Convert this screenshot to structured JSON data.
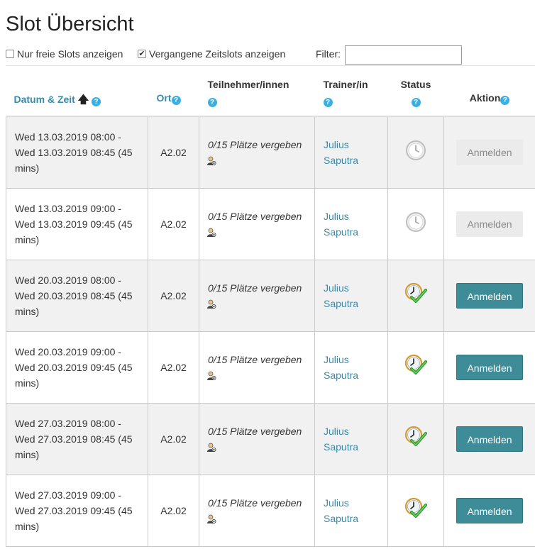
{
  "page": {
    "title": "Slot Übersicht"
  },
  "controls": {
    "free_only_label": "Nur freie Slots anzeigen",
    "free_only_checked": false,
    "past_label": "Vergangene Zeitslots anzeigen",
    "past_checked": true,
    "filter_label": "Filter:",
    "filter_value": ""
  },
  "table": {
    "headers": {
      "datum": "Datum & Zeit",
      "ort": "Ort",
      "teilnehmer": "Teilnehmer/innen",
      "trainer": "Trainer/in",
      "status": "Status",
      "aktion": "Aktion"
    },
    "help_glyph": "?",
    "sort_glyph": "🡅",
    "rows": [
      {
        "datum": "Wed 13.03.2019 08:00 - Wed 13.03.2019 08:45 (45 mins)",
        "ort": "A2.02",
        "teilnehmer": "0/15 Plätze vergeben",
        "trainer": "Julius Saputra",
        "status": "past-clock-icon",
        "action": "Anmelden",
        "action_enabled": false
      },
      {
        "datum": "Wed 13.03.2019 09:00 - Wed 13.03.2019 09:45 (45 mins)",
        "ort": "A2.02",
        "teilnehmer": "0/15 Plätze vergeben",
        "trainer": "Julius Saputra",
        "status": "past-clock-icon",
        "action": "Anmelden",
        "action_enabled": false
      },
      {
        "datum": "Wed 20.03.2019 08:00 - Wed 20.03.2019 08:45 (45 mins)",
        "ort": "A2.02",
        "teilnehmer": "0/15 Plätze vergeben",
        "trainer": "Julius Saputra",
        "status": "open-clock-check-icon",
        "action": "Anmelden",
        "action_enabled": true
      },
      {
        "datum": "Wed 20.03.2019 09:00 - Wed 20.03.2019 09:45 (45 mins)",
        "ort": "A2.02",
        "teilnehmer": "0/15 Plätze vergeben",
        "trainer": "Julius Saputra",
        "status": "open-clock-check-icon",
        "action": "Anmelden",
        "action_enabled": true
      },
      {
        "datum": "Wed 27.03.2019 08:00 - Wed 27.03.2019 08:45 (45 mins)",
        "ort": "A2.02",
        "teilnehmer": "0/15 Plätze vergeben",
        "trainer": "Julius Saputra",
        "status": "open-clock-check-icon",
        "action": "Anmelden",
        "action_enabled": true
      },
      {
        "datum": "Wed 27.03.2019 09:00 - Wed 27.03.2019 09:45 (45 mins)",
        "ort": "A2.02",
        "teilnehmer": "0/15 Plätze vergeben",
        "trainer": "Julius Saputra",
        "status": "open-clock-check-icon",
        "action": "Anmelden",
        "action_enabled": true
      }
    ]
  },
  "colors": {
    "accent": "#3f8c99",
    "link": "#3a8aa8",
    "help": "#3ab0e2",
    "row_alt": "#f1f1f1"
  }
}
